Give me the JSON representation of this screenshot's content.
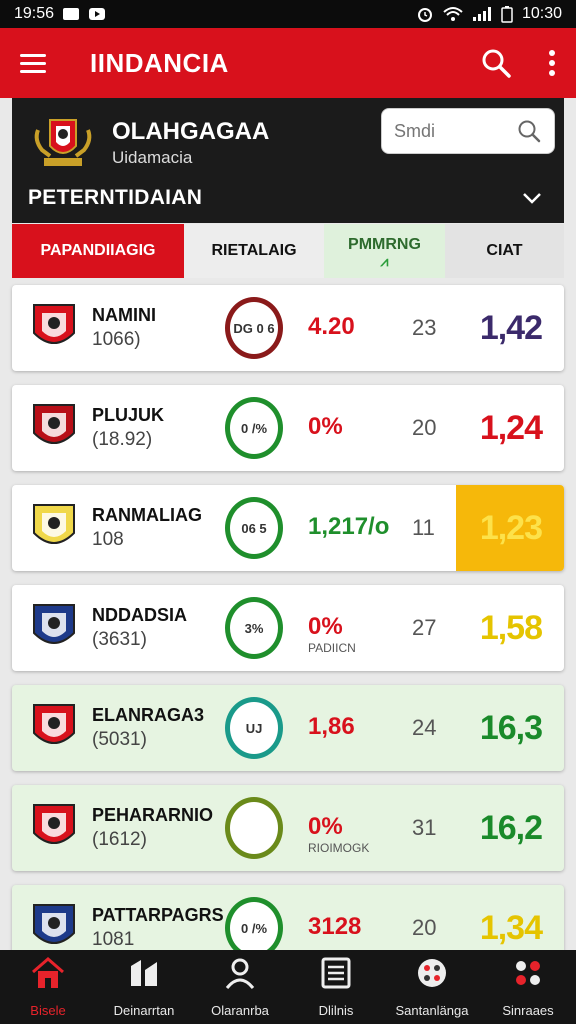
{
  "status": {
    "time_left": "19:56",
    "time_right": "10:30"
  },
  "app": {
    "title": "IINDANCIA"
  },
  "club": {
    "name": "OLAHGAGAA",
    "subtitle": "Uidamacia"
  },
  "search": {
    "placeholder": "Smdi"
  },
  "season": {
    "label": "PETERNTIDAIAN"
  },
  "tabs": [
    {
      "label": "PAPANDIIAGIG"
    },
    {
      "label": "RIETALAIG"
    },
    {
      "label": "PMMRNG"
    },
    {
      "label": "CIAT"
    }
  ],
  "rows": [
    {
      "name": "NAMINI",
      "year": "1066)",
      "ring": "DG 0 6",
      "stat": "4.20",
      "stat_color": "#d8111c",
      "stat_sub": "",
      "count": "23",
      "score": "1,42",
      "score_color": "#3b2a6b",
      "highlight": false,
      "bg": "white",
      "ring_color": "#8a1a1a"
    },
    {
      "name": "PLUJUK",
      "year": "(18.92)",
      "ring": "0 /%",
      "stat": "0%",
      "stat_color": "#d8111c",
      "stat_sub": "",
      "count": "20",
      "score": "1,24",
      "score_color": "#d8111c",
      "highlight": false,
      "bg": "white",
      "ring_color": "#1f8f2c"
    },
    {
      "name": "RANMALIAG",
      "year": "108",
      "ring": "06 5",
      "stat": "1,217/o",
      "stat_color": "#1f8f2c",
      "stat_sub": "",
      "count": "11",
      "score": "1,23",
      "score_color": "#fde24a",
      "highlight": true,
      "bg": "white",
      "ring_color": "#1f8f2c"
    },
    {
      "name": "NDDADSIA",
      "year": "(3631)",
      "ring": "3%",
      "stat": "0%",
      "stat_color": "#d8111c",
      "stat_sub": "PADIICN",
      "count": "27",
      "score": "1,58",
      "score_color": "#e5c400",
      "highlight": false,
      "bg": "white",
      "ring_color": "#1f8f2c"
    },
    {
      "name": "ELANRAGA3",
      "year": "(5031)",
      "ring": "UJ",
      "stat": "1,86",
      "stat_color": "#d8111c",
      "stat_sub": "",
      "count": "24",
      "score": "16,3",
      "score_color": "#1a8a2a",
      "highlight": false,
      "bg": "green",
      "ring_color": "#1a9a8a"
    },
    {
      "name": "PEHARARNIO",
      "year": "(1612)",
      "ring": "",
      "stat": "0%",
      "stat_color": "#d8111c",
      "stat_sub": "RIOIMOGK",
      "count": "31",
      "score": "16,2",
      "score_color": "#1a8a2a",
      "highlight": false,
      "bg": "green",
      "ring_color": "#6a8a1a"
    },
    {
      "name": "PATTARPAGRS",
      "year": "1081",
      "ring": "0 /%",
      "stat": "3128",
      "stat_color": "#d8111c",
      "stat_sub": "",
      "count": "20",
      "score": "1,34",
      "score_color": "#e5c400",
      "highlight": false,
      "bg": "green",
      "ring_color": "#1f8f2c"
    }
  ],
  "nav": [
    {
      "label": "Bisele",
      "icon": "home-icon"
    },
    {
      "label": "Deinarrtan",
      "icon": "transfer-icon"
    },
    {
      "label": "Olaranrba",
      "icon": "person-icon"
    },
    {
      "label": "Dlilnis",
      "icon": "list-icon"
    },
    {
      "label": "Santanlänga",
      "icon": "ball-icon"
    },
    {
      "label": "Sinraaes",
      "icon": "grid-icon"
    }
  ]
}
